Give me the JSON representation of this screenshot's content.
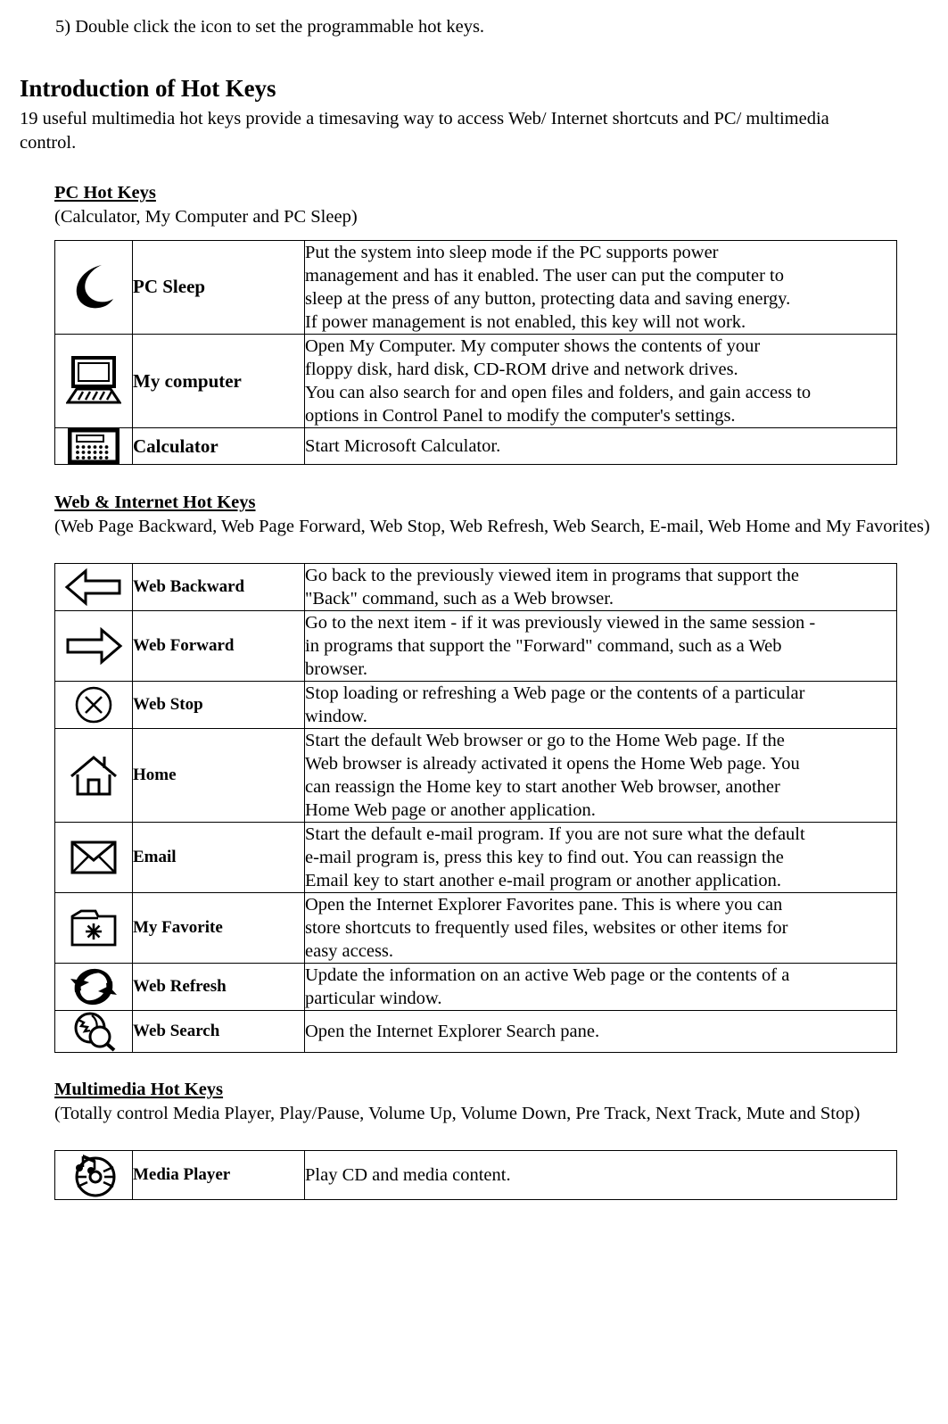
{
  "step_note": "5) Double click the icon to set the programmable hot keys.",
  "section": {
    "title": "Introduction of Hot Keys",
    "intro_line1": "19 useful multimedia hot keys provide a timesaving way to access Web/ Internet shortcuts and PC/",
    "intro_line2": "multimedia control."
  },
  "groups": [
    {
      "heading": "PC Hot Keys",
      "subtitle_line1": "(Calculator, My Computer and PC Sleep)",
      "subtitle_line2": "",
      "rows": [
        {
          "icon": "crescent-moon-icon",
          "name": "PC Sleep",
          "desc_lines": [
            "Put the system into sleep mode if the PC supports power",
            "management and has it enabled. The user can put the computer to",
            "sleep at the press of any button, protecting data and saving energy.",
            "If power management is not enabled, this key will not work."
          ]
        },
        {
          "icon": "computer-monitor-icon",
          "name": "My computer",
          "desc_lines": [
            "Open My Computer. My computer shows the contents of your",
            "floppy disk, hard disk, CD-ROM drive and network drives.",
            "You can also search for and open files and folders, and gain access to",
            "options in Control Panel to modify the computer's settings."
          ]
        },
        {
          "icon": "calculator-icon",
          "name": "Calculator",
          "desc_lines": [
            "Start Microsoft Calculator."
          ]
        }
      ]
    },
    {
      "heading": "Web & Internet Hot Keys",
      "subtitle_line1": "(Web Page Backward, Web Page Forward, Web Stop, Web Refresh, Web Search, E-mail, Web Home and",
      "subtitle_line2": "My Favorites)",
      "rows": [
        {
          "icon": "arrow-left-icon",
          "name": "Web Backward",
          "desc_lines": [
            "Go back to the previously viewed item in programs that support the",
            "\"Back\" command, such as a Web browser."
          ]
        },
        {
          "icon": "arrow-right-icon",
          "name": "Web Forward",
          "desc_lines": [
            "Go to the next item - if it was previously viewed in the same session -",
            "in programs that support the \"Forward\" command, such as a Web",
            "browser."
          ]
        },
        {
          "icon": "circle-x-stop-icon",
          "name": "Web Stop",
          "desc_lines": [
            "Stop loading or refreshing a Web page or the contents of a particular",
            "window."
          ]
        },
        {
          "icon": "house-home-icon",
          "name": "Home",
          "desc_lines": [
            "Start the default Web browser or go to the Home Web page. If the",
            "Web browser is already activated it opens the Home Web page. You",
            "can reassign the Home key to start another Web browser, another",
            "Home Web page or another application."
          ]
        },
        {
          "icon": "envelope-email-icon",
          "name": "Email",
          "desc_lines": [
            "Start the default e-mail program. If you are not sure what the default",
            "e-mail program is, press this key to find out. You can reassign the",
            "Email key to start another e-mail program or another application."
          ]
        },
        {
          "icon": "folder-star-favorite-icon",
          "name": "My Favorite",
          "desc_lines": [
            "Open the Internet Explorer Favorites pane. This is where you can",
            "store shortcuts to frequently used files, websites or other items for",
            "easy access."
          ]
        },
        {
          "icon": "refresh-arrows-icon",
          "name": "Web Refresh",
          "desc_lines": [
            "Update the information on an active Web page or the contents of a",
            "particular window."
          ]
        },
        {
          "icon": "globe-magnifier-search-icon",
          "name": "Web Search",
          "desc_lines": [
            "Open the Internet Explorer Search pane."
          ]
        }
      ]
    },
    {
      "heading": "Multimedia Hot Keys",
      "subtitle_line1": "(Totally control Media Player, Play/Pause, Volume Up, Volume Down, Pre Track, Next Track, Mute and",
      "subtitle_line2": "Stop)",
      "rows": [
        {
          "icon": "cd-music-note-icon",
          "name": "Media Player",
          "desc_lines": [
            "Play CD and media content."
          ]
        }
      ]
    }
  ],
  "colors": {
    "text": "#000000",
    "border": "#000000",
    "background": "#ffffff"
  }
}
